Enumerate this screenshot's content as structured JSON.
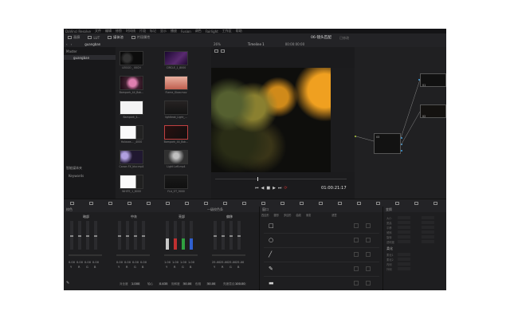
{
  "menu": [
    "DaVinci Resolve",
    "文件",
    "编辑",
    "修剪",
    "时间线",
    "片段",
    "标记",
    "显示",
    "播放",
    "Fusion",
    "调色",
    "Fairlight",
    "工作区",
    "帮助"
  ],
  "toolbar": {
    "items": [
      "画廊",
      "LUT",
      "媒体池",
      "片段属性"
    ],
    "project_title": "06-镜头匹配",
    "project_subtitle": "已修改",
    "zoom": "26%",
    "timeline": "Timeline 1",
    "timecode_top": "00:00:00:00"
  },
  "media_pool": {
    "folder_root": "Master",
    "selected_folder": "guangban",
    "tree_item": "guangban",
    "smart_bins": "智能媒体夹",
    "keywords": "Keywords",
    "clips": [
      {
        "label": "LEGGO _ 00CH"
      },
      {
        "label": "CIRCLE_1_8000"
      },
      {
        "label": "Bampark_44_Bok..."
      },
      {
        "label": "Flame_Glow.mov"
      },
      {
        "label": "Bampark_4..."
      },
      {
        "label": "lightleak_Light_..."
      },
      {
        "label": "Holosea... _4000"
      },
      {
        "label": "Bampark_44_Bok..."
      },
      {
        "label": "Canon FX_blur.mp4"
      },
      {
        "label": "Light Left.mp4"
      },
      {
        "label": "WHITE_1_8000"
      },
      {
        "label": "FLA_OT_9000"
      }
    ]
  },
  "viewer": {
    "timecode": "01:00:21:17"
  },
  "nodes": [
    {
      "label": "01"
    },
    {
      "label": "02"
    },
    {
      "label": "03"
    }
  ],
  "color_wheels": {
    "title": "校色",
    "mode": "一级校色条",
    "wheels": [
      {
        "name": "暗部",
        "values": [
          "0.00",
          "0.00",
          "0.00",
          "0.00"
        ]
      },
      {
        "name": "中灰",
        "values": [
          "0.00",
          "0.00",
          "0.00",
          "0.00"
        ]
      },
      {
        "name": "亮部",
        "values": [
          "1.00",
          "1.00",
          "1.00",
          "1.00"
        ]
      },
      {
        "name": "偏移",
        "values": [
          "25.00",
          "25.00",
          "25.00",
          "25.00"
        ]
      }
    ],
    "channel_labels": [
      "Y",
      "R",
      "G",
      "B"
    ],
    "bottom": [
      {
        "label": "对比度",
        "value": "1.000"
      },
      {
        "label": "轴心",
        "value": "0.435"
      },
      {
        "label": "饱和度",
        "value": "50.00"
      },
      {
        "label": "色相",
        "value": "50.00"
      },
      {
        "label": "亮度混合",
        "value": "100.00"
      }
    ]
  },
  "window_panel": {
    "title": "窗口",
    "tools": [
      "四边形",
      "圆形",
      "多边形",
      "曲线",
      "渐变"
    ],
    "right_label": "遮罩"
  },
  "transform_panel": {
    "title": "变换",
    "soft_title": "柔化",
    "fields": [
      "大小",
      "宽高",
      "平移",
      "倾斜",
      "旋转",
      "透明度"
    ],
    "soft_fields": [
      "柔化1",
      "柔化2",
      "内侧",
      "外侧"
    ]
  }
}
